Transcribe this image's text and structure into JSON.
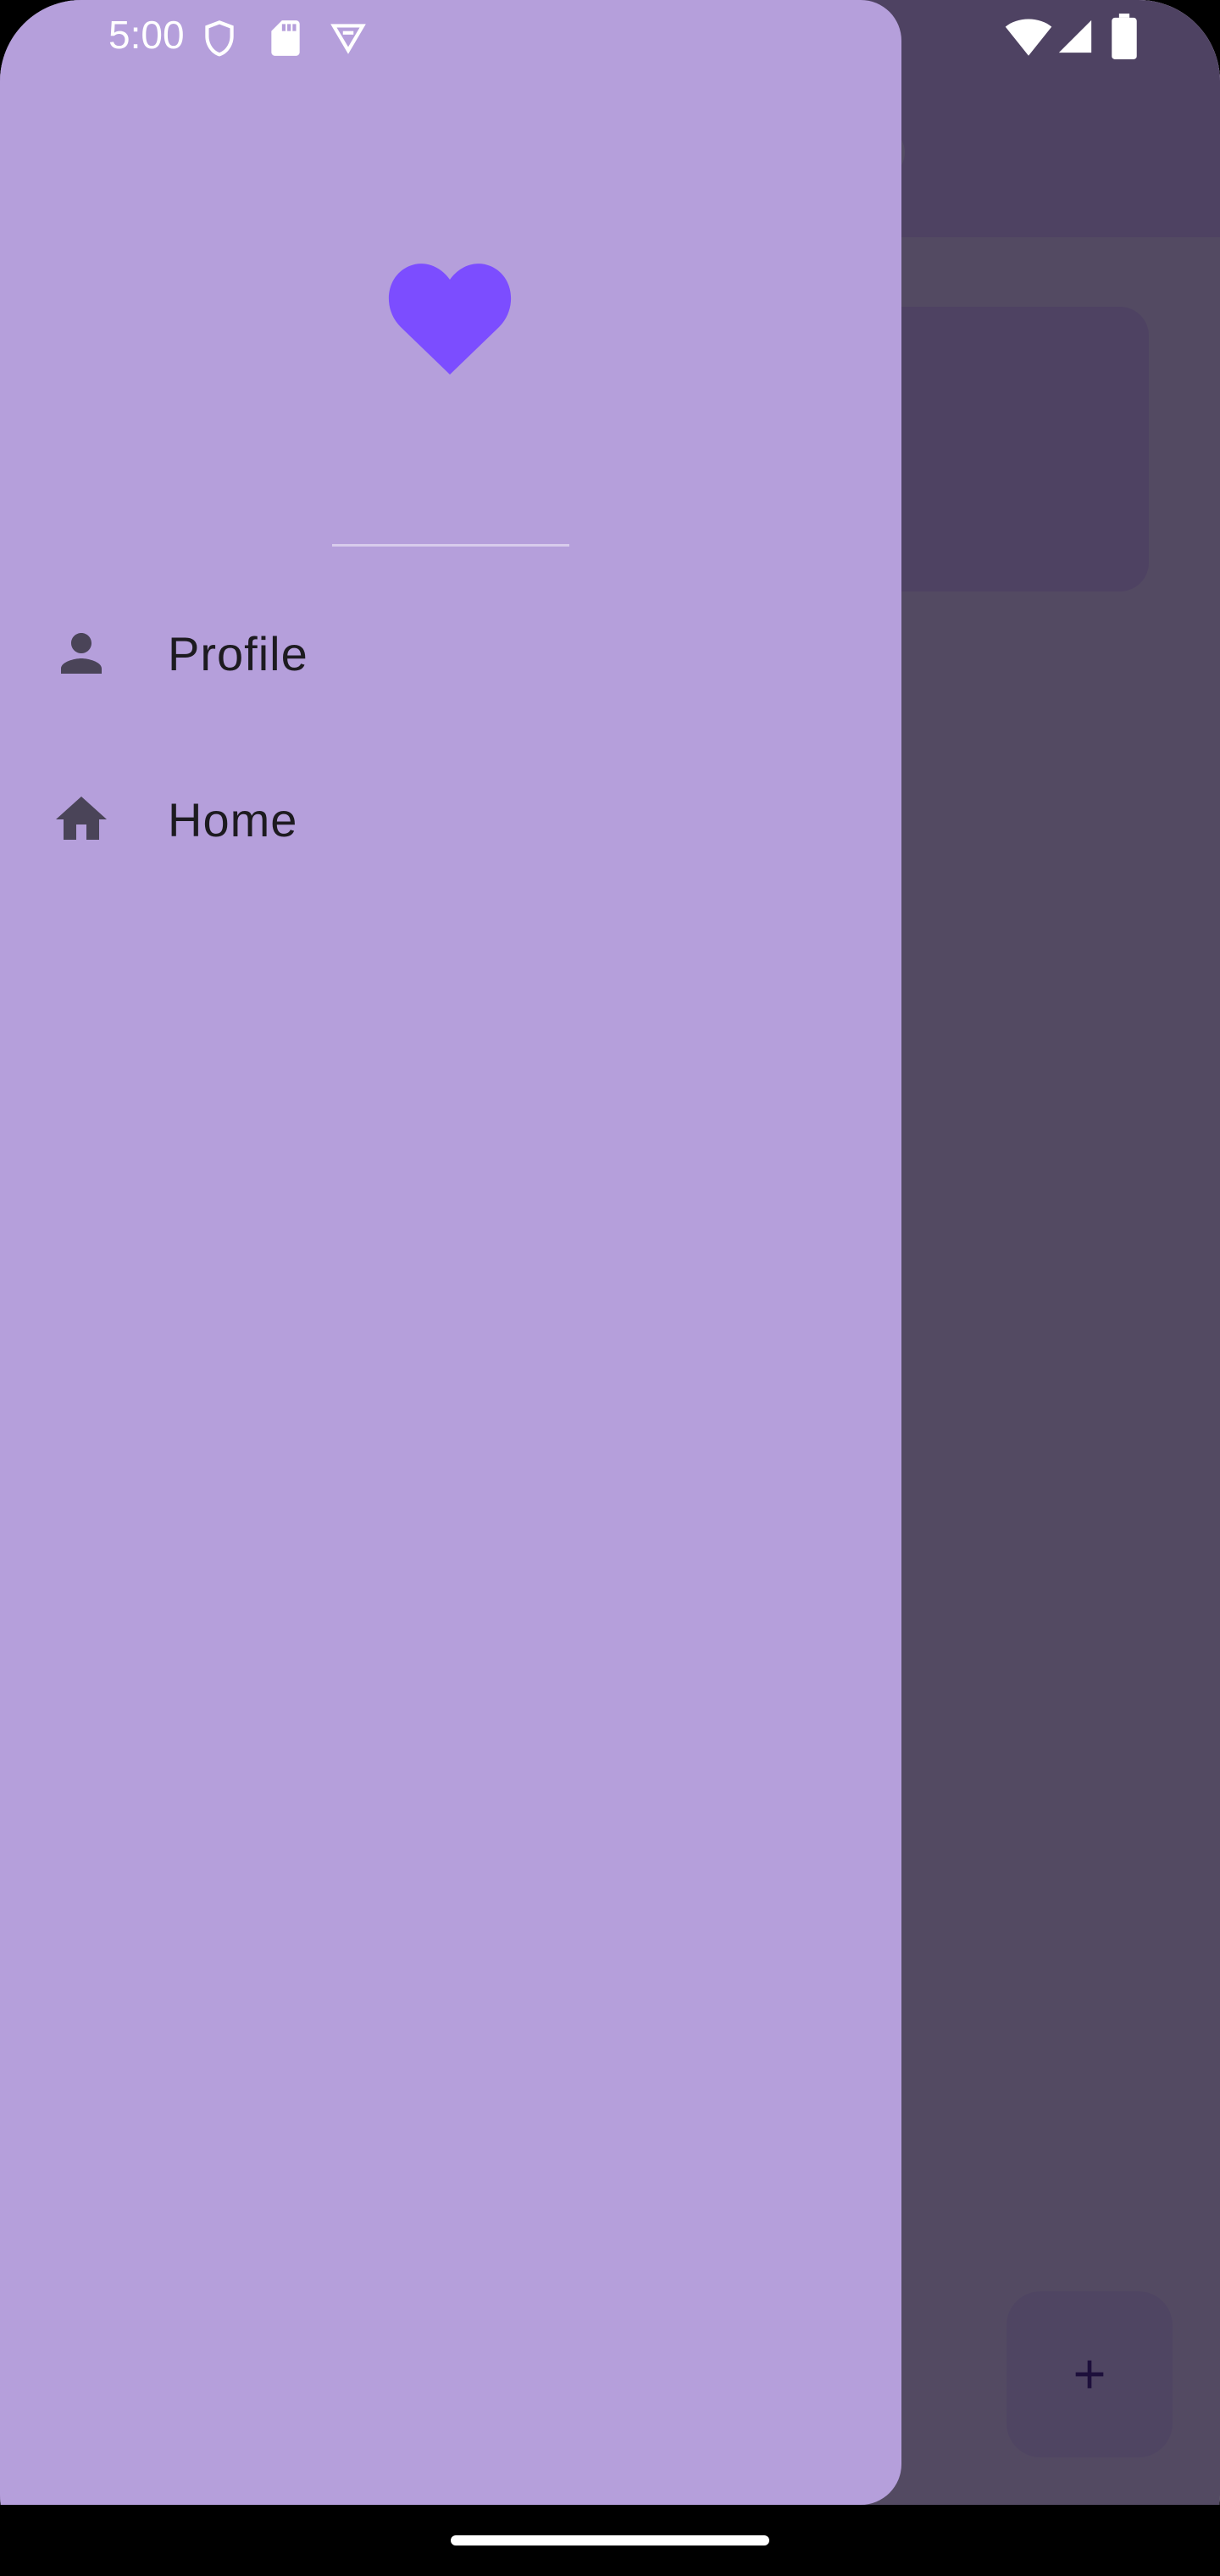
{
  "status_bar": {
    "time": "5:00",
    "left_icons": [
      "shield-icon",
      "sd-card-icon",
      "vpn-icon"
    ],
    "right_icons": [
      "wifi-icon",
      "signal-icon",
      "battery-icon"
    ]
  },
  "drawer": {
    "logo_icon": "heart-icon",
    "logo_color": "#7c4dff",
    "items": [
      {
        "label": "Profile",
        "icon": "person-icon"
      },
      {
        "label": "Home",
        "icon": "home-icon"
      }
    ]
  },
  "fab": {
    "icon": "plus-icon"
  },
  "colors": {
    "drawer_background": "#b59fdb",
    "app_bar": "#ead4ff",
    "scrim": "#1d1430",
    "item_icon": "#4a4458",
    "item_text": "#1d1b20"
  }
}
